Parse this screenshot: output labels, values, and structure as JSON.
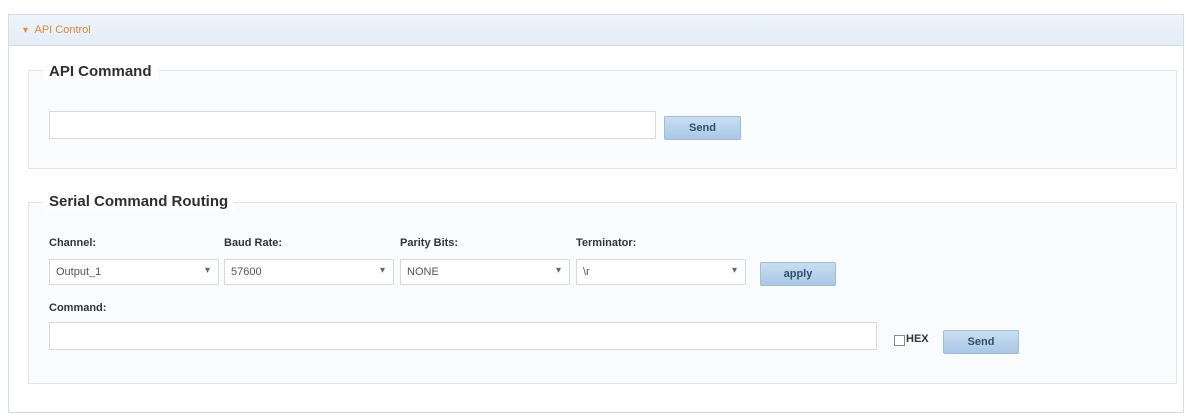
{
  "panel": {
    "header_caret": "▾",
    "header_title": "API Control"
  },
  "api_command": {
    "title": "API Command",
    "input_value": "",
    "send_label": "Send"
  },
  "serial_routing": {
    "title": "Serial Command Routing",
    "channel": {
      "label": "Channel:",
      "value": "Output_1"
    },
    "baud_rate": {
      "label": "Baud Rate:",
      "value": "57600"
    },
    "parity_bits": {
      "label": "Parity Bits:",
      "value": "NONE"
    },
    "terminator": {
      "label": "Terminator:",
      "value": "\\r"
    },
    "apply_label": "apply",
    "command_label": "Command:",
    "command_value": "",
    "hex_label": "HEX",
    "hex_checked": false,
    "send_label": "Send"
  },
  "colors": {
    "header_text": "#e1893a",
    "button_bg": "#b7d2ee"
  }
}
